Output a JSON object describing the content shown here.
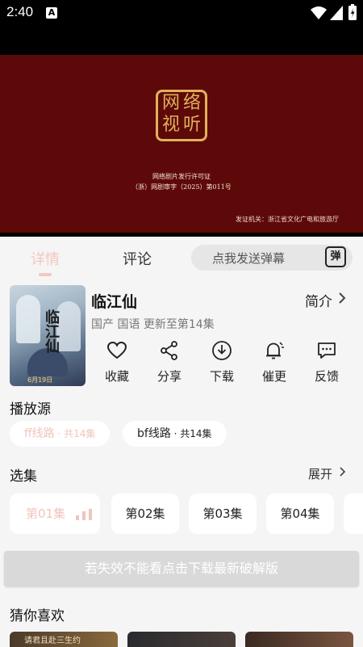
{
  "status_bar": {
    "time": "2:40",
    "app_icon": "A"
  },
  "video": {
    "seal_chars": [
      "网",
      "络",
      "视",
      "听"
    ],
    "license_line1": "网络剧片发行许可证",
    "license_line2": "（浙）网剧审字（2025）第011号",
    "issuer": "发证机关：浙江省文化广电和旅游厅"
  },
  "tabs": {
    "detail": "详情",
    "comment": "评论"
  },
  "danmaku": {
    "placeholder": "点我发送弹幕",
    "icon_text": "弹"
  },
  "show": {
    "poster_title": "临江仙",
    "poster_tag": "6月19日",
    "title": "临江仙",
    "intro_label": "简介",
    "meta": "国产 国语 更新至第14集"
  },
  "actions": [
    {
      "label": "收藏",
      "icon": "heart-icon"
    },
    {
      "label": "分享",
      "icon": "share-icon"
    },
    {
      "label": "下载",
      "icon": "download-icon"
    },
    {
      "label": "催更",
      "icon": "bell-icon"
    },
    {
      "label": "反馈",
      "icon": "feedback-icon"
    }
  ],
  "play_source": {
    "title": "播放源",
    "sources": [
      {
        "name": "ff线路",
        "count": " · 共14集"
      },
      {
        "name": "bf线路",
        "count": " · 共14集"
      }
    ]
  },
  "episodes": {
    "title": "选集",
    "expand_label": "展开",
    "items": [
      "第01集",
      "第02集",
      "第03集",
      "第04集"
    ]
  },
  "download_banner": "若失效不能看点击下载最新破解版",
  "recommend": {
    "title": "猜你喜欢",
    "first_snippet": "请君且赴三生约"
  },
  "colors": {
    "accent_light": "#f1c4bc",
    "video_bg": "#5e0909",
    "seal_gold": "#e0b15c"
  }
}
